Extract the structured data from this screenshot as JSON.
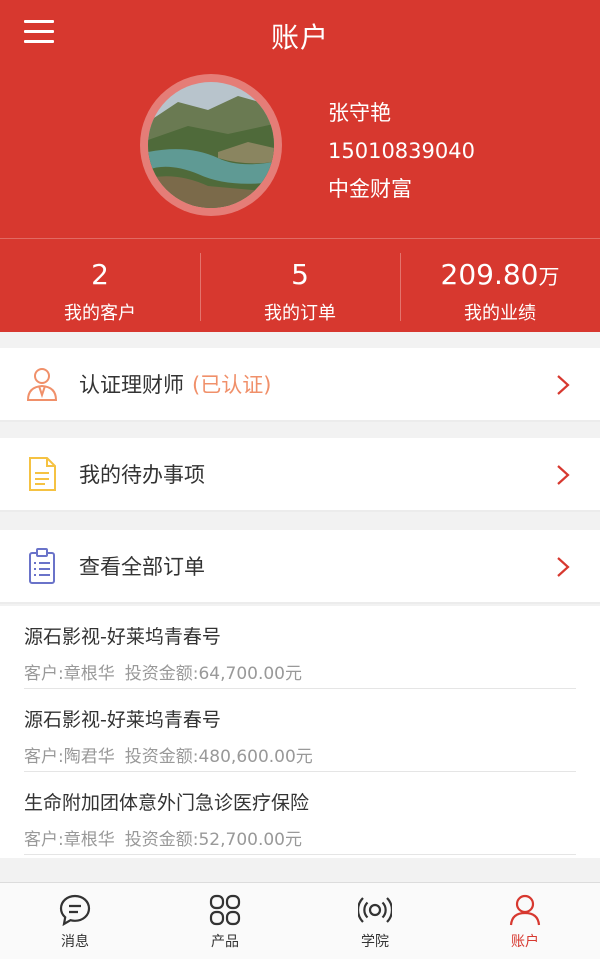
{
  "header": {
    "title": "账户"
  },
  "profile": {
    "name": "张守艳",
    "phone": "15010839040",
    "company": "中金财富"
  },
  "stats": [
    {
      "value": "2",
      "unit": "",
      "label": "我的客户"
    },
    {
      "value": "5",
      "unit": "",
      "label": "我的订单"
    },
    {
      "value": "209.80",
      "unit": "万",
      "label": "我的业绩"
    }
  ],
  "menu": {
    "certify": {
      "label": "认证理财师",
      "status": "(已认证)"
    },
    "todo": {
      "label": "我的待办事项"
    },
    "orders": {
      "label": "查看全部订单"
    }
  },
  "orders": [
    {
      "product": "源石影视-好莱坞青春号",
      "customer": "客户:章根华",
      "amount": "投资金额:64,700.00元"
    },
    {
      "product": "源石影视-好莱坞青春号",
      "customer": "客户:陶君华",
      "amount": "投资金额:480,600.00元"
    },
    {
      "product": "生命附加团体意外门急诊医疗保险",
      "customer": "客户:章根华",
      "amount": "投资金额:52,700.00元"
    }
  ],
  "tabs": [
    {
      "label": "消息",
      "icon": "message-icon"
    },
    {
      "label": "产品",
      "icon": "product-grid-icon"
    },
    {
      "label": "学院",
      "icon": "broadcast-icon"
    },
    {
      "label": "账户",
      "icon": "user-icon"
    }
  ],
  "colors": {
    "brand": "#d7382f",
    "certified": "#f0906a"
  }
}
